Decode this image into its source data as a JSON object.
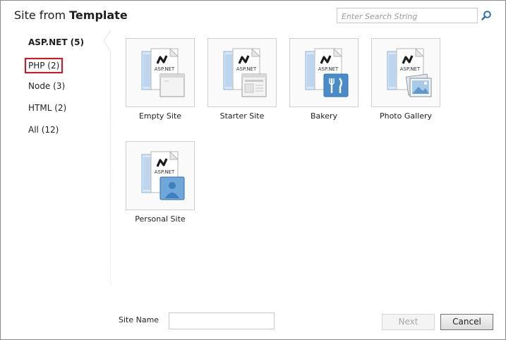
{
  "title": {
    "prefix": "Site from ",
    "emphasis": "Template"
  },
  "search": {
    "placeholder": "Enter Search String",
    "value": ""
  },
  "sidebar": {
    "items": [
      {
        "label": "ASP.NET (5)"
      },
      {
        "label": "PHP (2)"
      },
      {
        "label": "Node (3)"
      },
      {
        "label": "HTML (2)"
      },
      {
        "label": "All (12)"
      }
    ]
  },
  "templates": [
    {
      "label": "Empty Site",
      "badge_text": "ASP.NET",
      "overlay": "window-icon"
    },
    {
      "label": "Starter Site",
      "badge_text": "ASP.NET",
      "overlay": "starter-window-icon"
    },
    {
      "label": "Bakery",
      "badge_text": "ASP.NET",
      "overlay": "fork-knife-icon"
    },
    {
      "label": "Photo Gallery",
      "badge_text": "ASP.NET",
      "overlay": "photo-icon"
    },
    {
      "label": "Personal Site",
      "badge_text": "ASP.NET",
      "overlay": "person-icon"
    }
  ],
  "footer": {
    "site_name_label": "Site Name",
    "site_name_value": "",
    "next_label": "Next",
    "cancel_label": "Cancel"
  },
  "colors": {
    "focus_outline": "#e0101e",
    "search_icon": "#2f6fb5",
    "tile_accent": "#4a8cc9"
  }
}
